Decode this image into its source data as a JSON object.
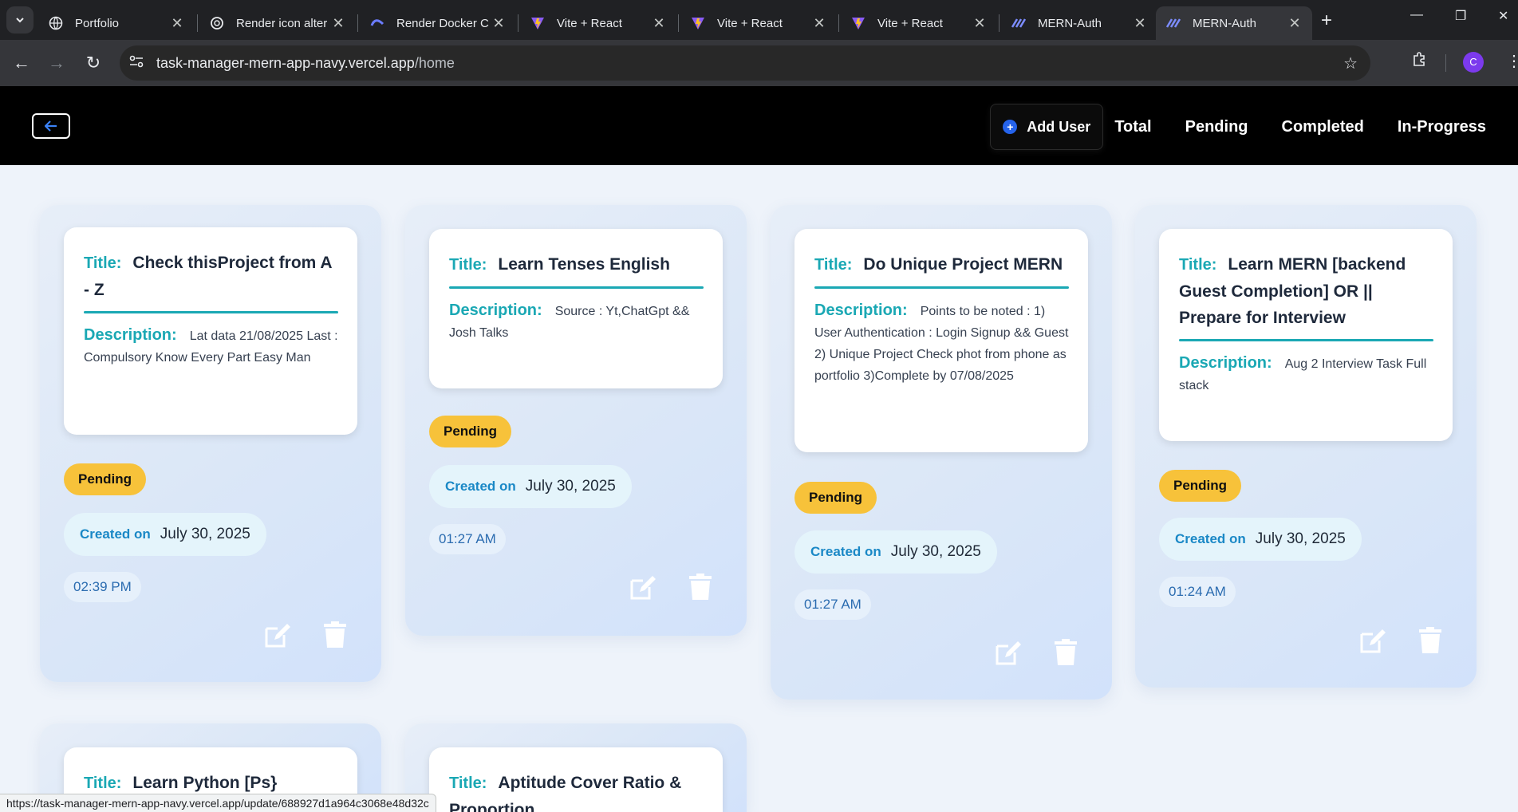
{
  "browser": {
    "tabs": [
      {
        "title": "Portfolio",
        "icon": "globe-icon"
      },
      {
        "title": "Render icon alter",
        "icon": "openai-icon"
      },
      {
        "title": "Render Docker C",
        "icon": "render-icon"
      },
      {
        "title": "Vite + React",
        "icon": "vite-icon"
      },
      {
        "title": "Vite + React",
        "icon": "vite-icon"
      },
      {
        "title": "Vite + React",
        "icon": "vite-icon"
      },
      {
        "title": "MERN-Auth",
        "icon": "mern-icon"
      },
      {
        "title": "MERN-Auth",
        "icon": "mern-icon"
      }
    ],
    "url_host": "task-manager-mern-app-navy.vercel.app",
    "url_path": "/home",
    "profile_initial": "C",
    "status_url": "https://task-manager-mern-app-navy.vercel.app/update/688927d1a964c3068e48d32c"
  },
  "header": {
    "add_user": "Add User",
    "nav": [
      "Total",
      "Pending",
      "Completed",
      "In-Progress"
    ]
  },
  "labels": {
    "title": "Title:",
    "description": "Description:",
    "created_on": "Created on"
  },
  "tasks": [
    {
      "title": "Check thisProject from A - Z",
      "description": "Lat data 21/08/2025 Last : Compulsory Know Every Part Easy Man",
      "status": "Pending",
      "date": "July 30, 2025",
      "time": "02:39 PM"
    },
    {
      "title": "Learn Tenses English",
      "description": "Source : Yt,ChatGpt && Josh Talks",
      "status": "Pending",
      "date": "July 30, 2025",
      "time": "01:27 AM"
    },
    {
      "title": "Do Unique Project MERN",
      "description": "Points to be noted : 1) User Authentication : Login Signup && Guest 2) Unique Project Check phot from phone as portfolio 3)Complete by 07/08/2025",
      "status": "Pending",
      "date": "July 30, 2025",
      "time": "01:27 AM"
    },
    {
      "title": "Learn MERN [backend Guest Completion] OR || Prepare for Interview",
      "description": "Aug 2 Interview Task Full stack",
      "status": "Pending",
      "date": "July 30, 2025",
      "time": "01:24 AM"
    },
    {
      "title": "Learn Python [Ps}"
    },
    {
      "title": "Aptitude Cover Ratio & Proportion"
    }
  ],
  "colors": {
    "accent_teal": "#1aa8b4",
    "status_pending": "#f7c23a",
    "header_bg": "#000000",
    "page_bg": "#eef3fa"
  }
}
